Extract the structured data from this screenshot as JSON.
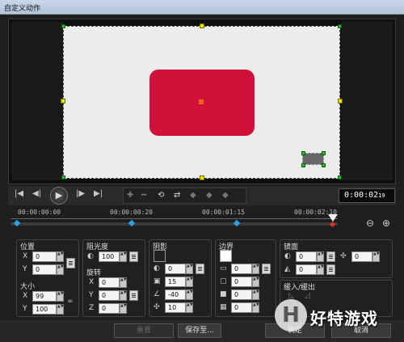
{
  "window": {
    "title": "自定义动作"
  },
  "transport": {
    "timecode_main": "0:00:02",
    "timecode_frame": "19"
  },
  "timeline": {
    "ticks": [
      "00:00:00:00",
      "00:00:00:20",
      "00:00:01:15",
      "00:00:02:10"
    ]
  },
  "position": {
    "title": "位置",
    "x_label": "X",
    "x": "0",
    "y_label": "Y",
    "y": "0"
  },
  "size": {
    "title": "大小",
    "x_label": "X",
    "x": "99",
    "y_label": "Y",
    "y": "100"
  },
  "opacity": {
    "title": "阻光度",
    "value": "100"
  },
  "rotation": {
    "title": "旋转",
    "x_label": "X",
    "x": "0",
    "y_label": "Y",
    "y": "0",
    "z_label": "Z",
    "z": "0"
  },
  "shadow": {
    "title": "阴影",
    "opacity": "0",
    "blur": "15",
    "angle": "-40",
    "distance": "10",
    "color": "#000000"
  },
  "border": {
    "title": "边界",
    "width": "0",
    "radius": "0",
    "spread": "0",
    "softness": "0",
    "color": "#ffffff"
  },
  "mirror": {
    "title": "镜面",
    "opacity": "0",
    "distance": "0",
    "fade": "0"
  },
  "fade": {
    "title": "缓入/缓出"
  },
  "footer": {
    "reset": "重置",
    "save_to": "保存至...",
    "ok": "确定",
    "cancel": "取消"
  },
  "watermark": {
    "glyph": "H",
    "text": "好特游戏"
  }
}
